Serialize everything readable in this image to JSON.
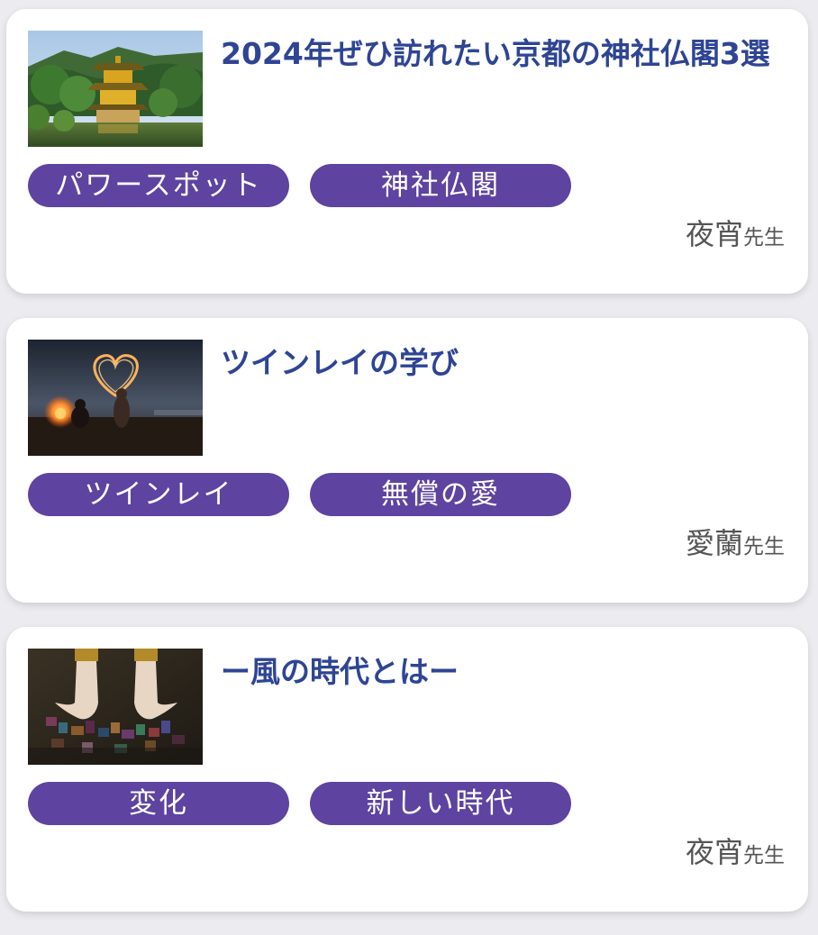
{
  "articles": [
    {
      "title": "2024年ぜひ訪れたい京都の神社仏閣3選",
      "thumbnail": "golden-pavilion-image",
      "tags": [
        "パワースポット",
        "神社仏閣"
      ],
      "author": "夜宵",
      "author_suffix": "先生"
    },
    {
      "title": "ツインレイの学び",
      "thumbnail": "light-heart-campfire-image",
      "tags": [
        "ツインレイ",
        "無償の愛"
      ],
      "author": "愛蘭",
      "author_suffix": "先生"
    },
    {
      "title": "ー風の時代とはー",
      "thumbnail": "hands-holding-image",
      "tags": [
        "変化",
        "新しい時代"
      ],
      "author": "夜宵",
      "author_suffix": "先生"
    }
  ],
  "colors": {
    "title": "#2e4594",
    "tag_bg": "#5e43a0",
    "tag_text": "#ffffff",
    "author": "#555555",
    "card_bg": "#ffffff",
    "page_bg": "#ececf0"
  }
}
